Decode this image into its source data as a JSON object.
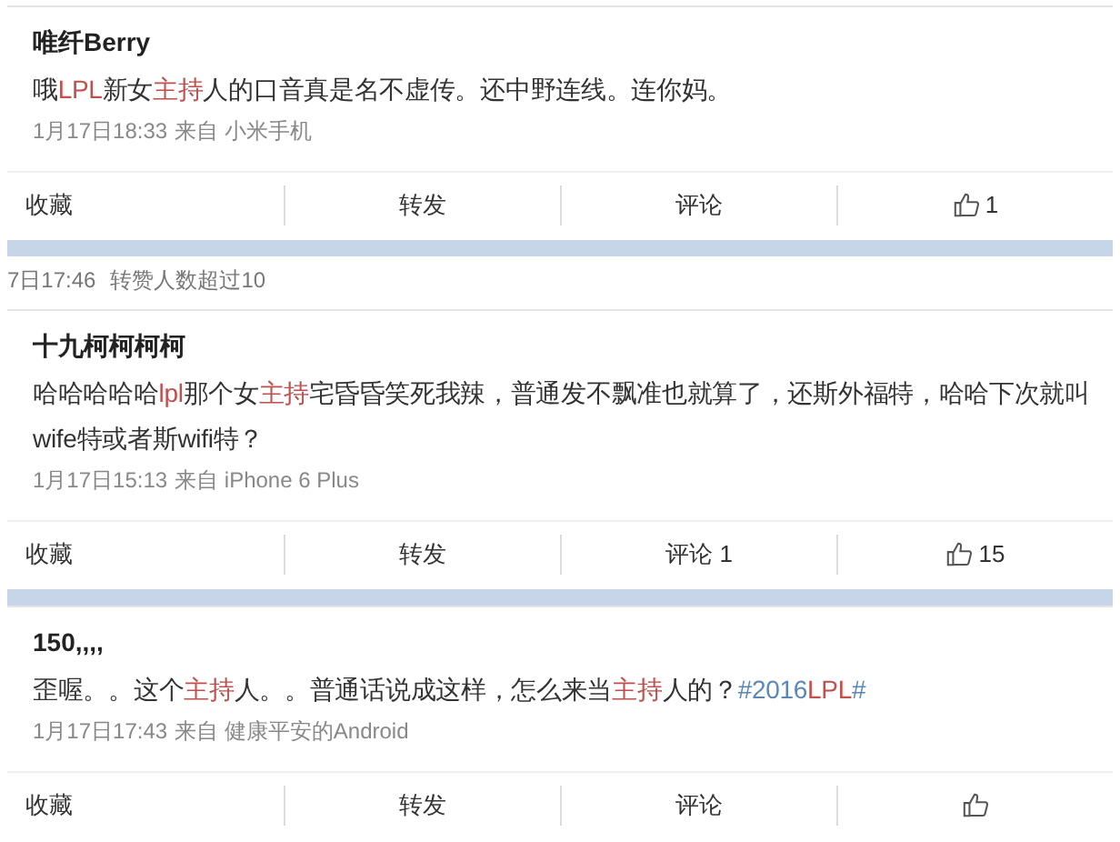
{
  "feed": [
    {
      "kind": "post",
      "author": "唯纤Berry",
      "text": [
        {
          "kind": "plain",
          "text": "哦"
        },
        {
          "kind": "match",
          "text": "LPL"
        },
        {
          "kind": "plain",
          "text": "新女"
        },
        {
          "kind": "match",
          "text": "主持"
        },
        {
          "kind": "plain",
          "text": "人的口音真是名不虚传。还中野连线。连你妈。"
        }
      ],
      "time": "1月17日18:33",
      "source_label": "来自",
      "source": "小米手机",
      "actions": [
        {
          "kind": "text",
          "label": "收藏"
        },
        {
          "kind": "text",
          "label": "转发"
        },
        {
          "kind": "text",
          "label": "评论"
        },
        {
          "kind": "like",
          "count": "1"
        }
      ]
    },
    {
      "kind": "separator"
    },
    {
      "kind": "strip",
      "time": "7日17:46",
      "note": "转赞人数超过10"
    },
    {
      "kind": "post",
      "author": "十九柯柯柯柯",
      "text": [
        {
          "kind": "plain",
          "text": "哈哈哈哈哈"
        },
        {
          "kind": "match",
          "text": "lpl"
        },
        {
          "kind": "plain",
          "text": "那个女"
        },
        {
          "kind": "match",
          "text": "主持"
        },
        {
          "kind": "plain",
          "text": "宅昏昏笑死我辣，普通发不飘准也就算了，还斯外福特，哈哈下次就叫wife特或者斯wifi特？"
        }
      ],
      "time": "1月17日15:13",
      "source_label": "来自",
      "source": "iPhone 6 Plus",
      "actions": [
        {
          "kind": "text",
          "label": "收藏"
        },
        {
          "kind": "text",
          "label": "转发"
        },
        {
          "kind": "text",
          "label": "评论",
          "count": "1"
        },
        {
          "kind": "like",
          "count": "15"
        }
      ]
    },
    {
      "kind": "separator"
    },
    {
      "kind": "post",
      "author": "150,,,,",
      "text": [
        {
          "kind": "plain",
          "text": "歪喔。。这个"
        },
        {
          "kind": "match",
          "text": "主持"
        },
        {
          "kind": "plain",
          "text": "人。。普通话说成这样，怎么来当"
        },
        {
          "kind": "match",
          "text": "主持"
        },
        {
          "kind": "plain",
          "text": "人的？"
        },
        {
          "kind": "topic",
          "parts": [
            {
              "text": "#2016",
              "match": false
            },
            {
              "text": "LPL",
              "match": true
            },
            {
              "text": "#",
              "match": false
            }
          ]
        }
      ],
      "time": "1月17日17:43",
      "source_label": "来自",
      "source": "健康平安的Android",
      "actions": [
        {
          "kind": "text",
          "label": "收藏"
        },
        {
          "kind": "text",
          "label": "转发"
        },
        {
          "kind": "text",
          "label": "评论"
        },
        {
          "kind": "like"
        }
      ]
    }
  ]
}
